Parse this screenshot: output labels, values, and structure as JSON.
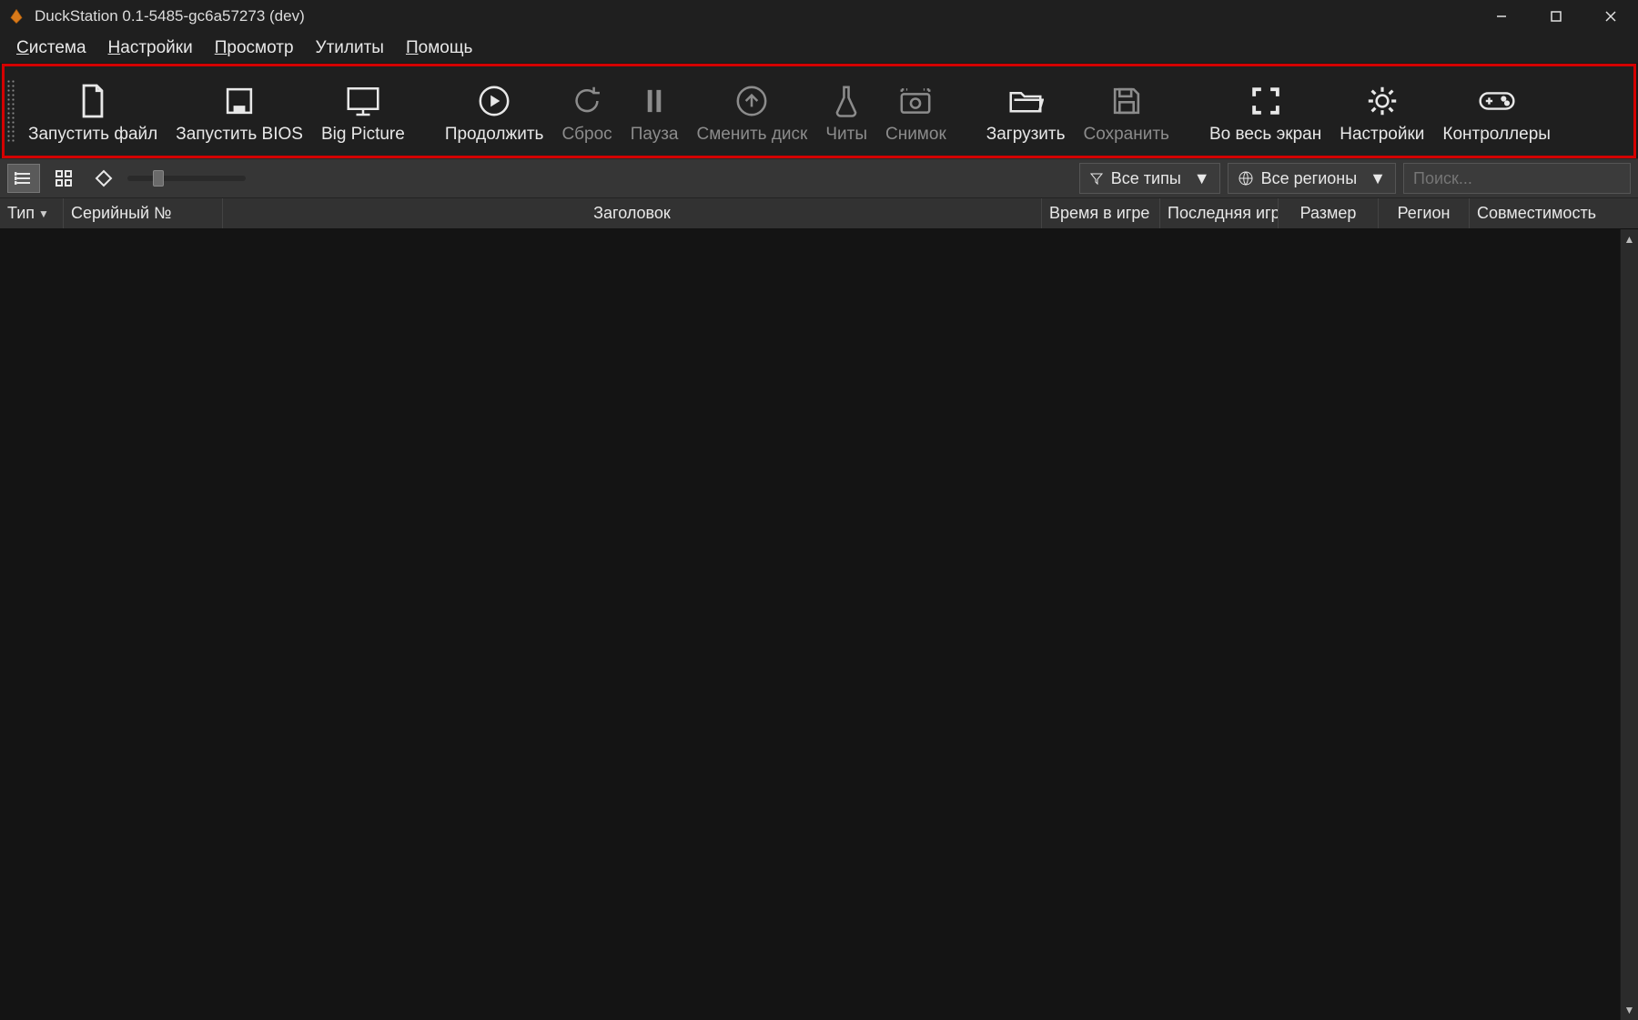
{
  "title": "DuckStation 0.1-5485-gc6a57273 (dev)",
  "menu": {
    "system": "Система",
    "settings": "Настройки",
    "view": "Просмотр",
    "utilities": "Утилиты",
    "help": "Помощь"
  },
  "toolbar": {
    "start_file": "Запустить файл",
    "start_bios": "Запустить BIOS",
    "big_picture": "Big Picture",
    "resume": "Продолжить",
    "reset": "Сброс",
    "pause": "Пауза",
    "change_disc": "Сменить диск",
    "cheats": "Читы",
    "screenshot": "Снимок",
    "load_state": "Загрузить",
    "save_state": "Сохранить",
    "fullscreen": "Во весь экран",
    "settings": "Настройки",
    "controllers": "Контроллеры"
  },
  "filter": {
    "all_types": "Все типы",
    "all_regions": "Все регионы",
    "search_placeholder": "Поиск..."
  },
  "columns": {
    "type": "Тип",
    "serial": "Серийный №",
    "title": "Заголовок",
    "time_played": "Время в игре",
    "last_played": "Последняя игр",
    "size": "Размер",
    "region": "Регион",
    "compat": "Совместимость"
  }
}
